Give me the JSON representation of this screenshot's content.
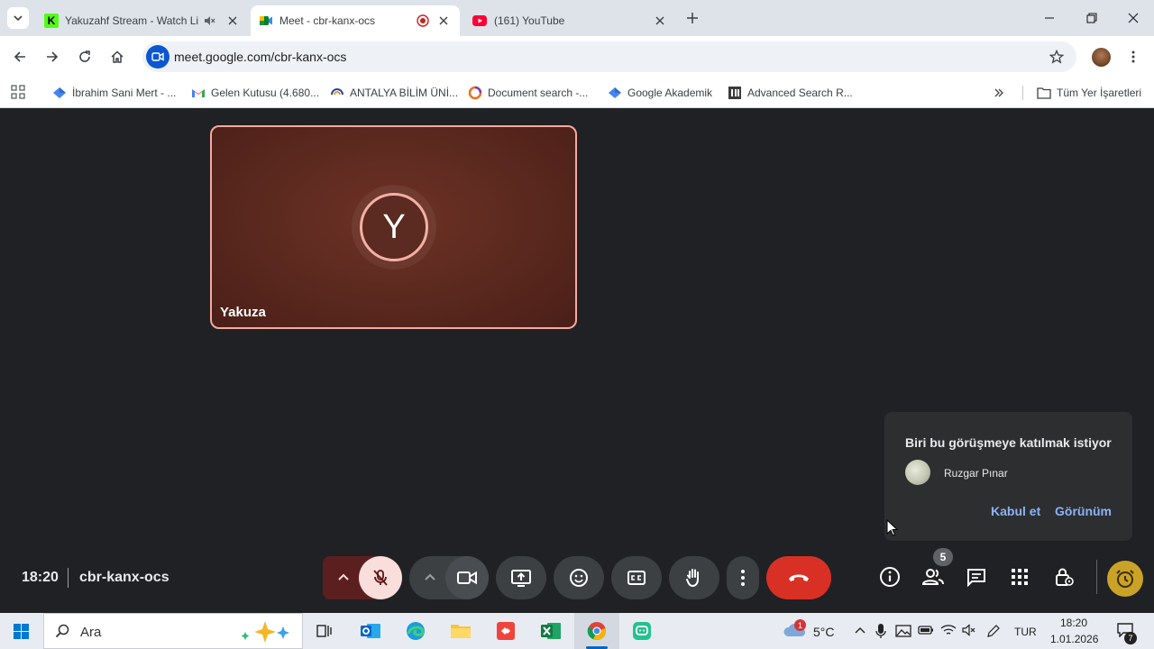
{
  "browser": {
    "tabs": [
      {
        "title": "Yakuzahf Stream - Watch Li",
        "icon": "kick-icon"
      },
      {
        "title": "Meet - cbr-kanx-ocs",
        "icon": "google-meet-icon",
        "active": true
      },
      {
        "title": "(161) YouTube",
        "icon": "youtube-icon"
      }
    ],
    "url": "meet.google.com/cbr-kanx-ocs",
    "bookmarks": [
      {
        "label": "İbrahim Sani Mert - ...",
        "icon": "scholar-icon"
      },
      {
        "label": "Gelen Kutusu (4.680...",
        "icon": "gmail-icon"
      },
      {
        "label": "ANTALYA BİLİM ÜNİ...",
        "icon": "university-icon"
      },
      {
        "label": "Document search -...",
        "icon": "scopus-icon"
      },
      {
        "label": "Google Akademik",
        "icon": "scholar-icon"
      },
      {
        "label": "Advanced Search R...",
        "icon": "ieee-icon"
      }
    ],
    "all_bookmarks": "Tüm Yer İşaretleri"
  },
  "meet": {
    "participant": {
      "initial": "Y",
      "name": "Yakuza"
    },
    "join_request": {
      "title": "Biri bu görüşmeye katılmak istiyor",
      "name": "Ruzgar Pınar",
      "accept": "Kabul et",
      "view": "Görünüm"
    },
    "time": "18:20",
    "code": "cbr-kanx-ocs",
    "people_count": "5",
    "colors": {
      "hangup": "#d93025",
      "mic_off_bg": "#f9dedc",
      "tile_border": "#f5a9a0",
      "link": "#8ab4f8"
    }
  },
  "taskbar": {
    "search_placeholder": "Ara",
    "weather": "5°C",
    "weather_badge": "1",
    "language": "TUR",
    "time": "18:20",
    "date": "1.01.2026",
    "notifications": "7"
  }
}
